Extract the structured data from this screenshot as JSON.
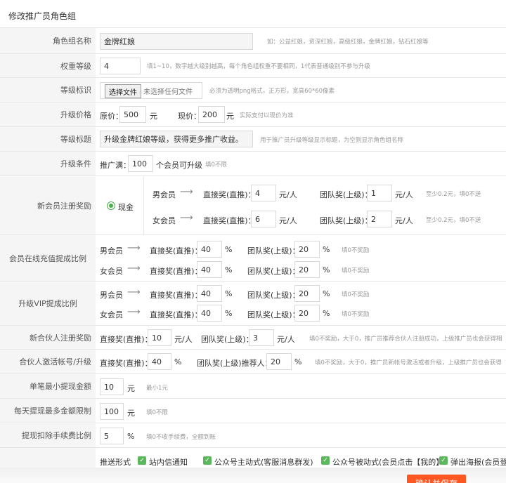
{
  "page_title": "修改推广员角色组",
  "role_name": {
    "label": "角色组名称",
    "value": "金牌红娘",
    "hint": "如：公益红娘，资深红娘，高级红娘，金牌红娘，钻石红娘等"
  },
  "weight": {
    "label": "权重等级",
    "value": "4",
    "hint": "填1~10，数字越大级别越高，每个角色组权重不要相同，1代表普通级别不参与升级"
  },
  "level_icon": {
    "label": "等级标识",
    "button": "选择文件",
    "no_file": "未选择任何文件",
    "hint": "必须为透明png格式，正方形，宽高60*60像素"
  },
  "upgrade_price": {
    "label": "升级价格",
    "orig_label": "原价：",
    "orig_value": "500",
    "orig_unit": "元",
    "now_label": "现价：",
    "now_value": "200",
    "now_unit": "元",
    "hint": "实际支付以现价为准"
  },
  "level_title": {
    "label": "等级标题",
    "value": "升级金牌红娘等级，获得更多推广收益。",
    "hint": "用于推广员升级等级显示标题，为空则显示角色组名称"
  },
  "upgrade_cond": {
    "label": "升级条件",
    "prefix": "推广满：",
    "value": "100",
    "suffix": "个会员可升级",
    "hint": "填0不限"
  },
  "register_reward": {
    "label": "新会员注册奖励",
    "radio_label": "现金",
    "arrow": "⟶",
    "rows": [
      {
        "who": "男会员",
        "direct_label": "直接奖(直推)：",
        "direct": "4",
        "direct_unit": "元/人",
        "team_label": "团队奖(上级)：",
        "team": "1",
        "team_unit": "元/人",
        "hint": "至少0.2元，填0不送"
      },
      {
        "who": "女会员",
        "direct_label": "直接奖(直推)：",
        "direct": "6",
        "direct_unit": "元/人",
        "team_label": "团队奖(上级)：",
        "team": "2",
        "team_unit": "元/人",
        "hint": "至少0.2元，填0不送"
      }
    ]
  },
  "recharge_ratio": {
    "label": "会员在线充值提成比例",
    "rows": [
      {
        "who": "男会员",
        "direct_label": "直接奖(直推)：",
        "direct": "40",
        "team_label": "团队奖(上级)：",
        "team": "20",
        "unit": "%",
        "hint": "填0不奖励"
      },
      {
        "who": "女会员",
        "direct_label": "直接奖(直推)：",
        "direct": "40",
        "team_label": "团队奖(上级)：",
        "team": "20",
        "unit": "%",
        "hint": "填0不奖励"
      }
    ]
  },
  "vip_ratio": {
    "label": "升级VIP提成比例",
    "rows": [
      {
        "who": "男会员",
        "direct_label": "直接奖(直推)：",
        "direct": "40",
        "team_label": "团队奖(上级)：",
        "team": "20",
        "unit": "%",
        "hint": "填0不奖励"
      },
      {
        "who": "女会员",
        "direct_label": "直接奖(直推)：",
        "direct": "40",
        "team_label": "团队奖(上级)：",
        "team": "20",
        "unit": "%",
        "hint": "填0不奖励"
      }
    ]
  },
  "partner_register": {
    "label": "新合伙人注册奖励",
    "direct_label": "直接奖(直推)：",
    "direct": "10",
    "direct_unit": "元/人",
    "team_label": "团队奖(上级)：",
    "team": "3",
    "team_unit": "元/人",
    "hint": "填0不奖励，大于0，推广员推荐合伙人注册成功，上级推广员也会获得相"
  },
  "partner_activate": {
    "label": "合伙人激活帐号/升级",
    "direct_label": "直接奖(直推)：",
    "direct": "40",
    "direct_unit": "%",
    "team_label": "团队奖(上级)推荐人：",
    "team": "20",
    "team_unit": "%",
    "hint": "填0不奖励，大于0，推广员新帐号激活或者升级，上级推广员也会获得"
  },
  "min_withdraw": {
    "label": "单笔最小提现金额",
    "value": "10",
    "unit": "元",
    "hint": "最小1元"
  },
  "daily_max": {
    "label": "每天提现最多金额限制",
    "value": "100",
    "unit": "元",
    "hint": "填0不限"
  },
  "fee_ratio": {
    "label": "提现扣除手续费比例",
    "value": "5",
    "unit": "%",
    "hint": "填0不收手续费，全额到账"
  },
  "push": {
    "label": "推送形式",
    "options": [
      "站内信通知",
      "公众号主动式(客服消息群发)",
      "公众号被动式(会员点击【我的】",
      "弹出海报(会员登录"
    ]
  },
  "save_button": "确认并保存",
  "colors": {
    "accent": "#ff5722",
    "check": "#5cb85c",
    "label_bg": "#f5f5f5"
  }
}
